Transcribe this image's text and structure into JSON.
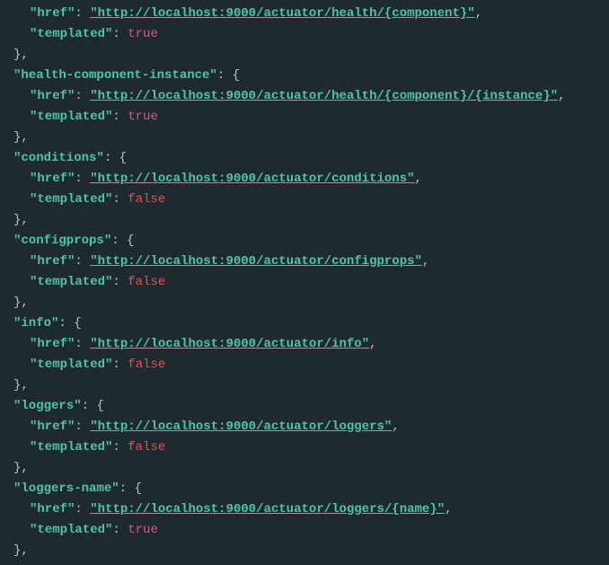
{
  "entries": [
    {
      "key_shown": false,
      "key": "",
      "href": "http://localhost:9000/actuator/health/{component}",
      "templated": true
    },
    {
      "key_shown": true,
      "key": "health-component-instance",
      "href": "http://localhost:9000/actuator/health/{component}/{instance}",
      "templated": true
    },
    {
      "key_shown": true,
      "key": "conditions",
      "href": "http://localhost:9000/actuator/conditions",
      "templated": false
    },
    {
      "key_shown": true,
      "key": "configprops",
      "href": "http://localhost:9000/actuator/configprops",
      "templated": false
    },
    {
      "key_shown": true,
      "key": "info",
      "href": "http://localhost:9000/actuator/info",
      "templated": false
    },
    {
      "key_shown": true,
      "key": "loggers",
      "href": "http://localhost:9000/actuator/loggers",
      "templated": false
    },
    {
      "key_shown": true,
      "key": "loggers-name",
      "href": "http://localhost:9000/actuator/loggers/{name}",
      "templated": true
    }
  ],
  "labels": {
    "href": "href",
    "templated": "templated",
    "true": "true",
    "false": "false"
  }
}
